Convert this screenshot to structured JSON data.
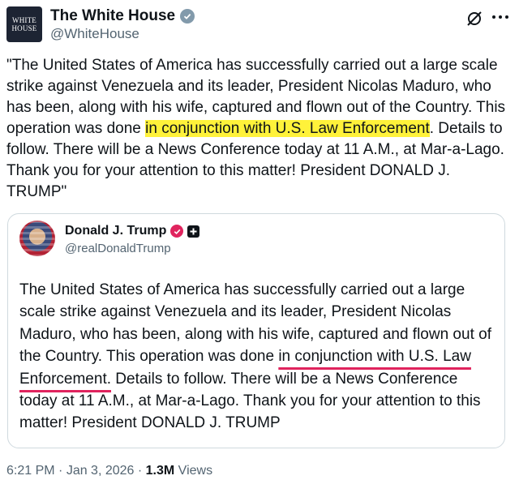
{
  "post": {
    "author_name": "The White House",
    "author_handle": "@WhiteHouse",
    "avatar_text_line1": "WHITE",
    "avatar_text_line2": "HOUSE",
    "text_before_highlight": "\"The United States of America has successfully carried out a large scale strike against Venezuela and its leader, President Nicolas Maduro, who has been, along with his wife, captured and flown out of the Country. This operation was done ",
    "text_highlight": "in conjunction with U.S. Law Enforcement",
    "text_after_highlight": ". Details to follow. There will be a News Conference today at 11 A.M., at Mar-a-Lago. Thank you for your attention to this matter! President DONALD J. TRUMP\"",
    "highlight_color": "#fff23a"
  },
  "quoted_post": {
    "author_name": "Donald J. Trump",
    "author_handle": "@realDonaldTrump",
    "text_before_underline": "The United States of America has successfully carried out a large scale strike against Venezuela and its leader, President Nicolas Maduro, who has been, along with his wife, captured and flown out of the Country. This operation was done ",
    "text_underlined": "in conjunction with U.S. Law Enforcement.",
    "text_after_underline": " Details to follow. There will be a News Conference today at 11 A.M., at Mar-a-Lago. Thank you for your attention to this matter! President DONALD J. TRUMP",
    "underline_color": "#e0245e",
    "badge_color": "#e0245e"
  },
  "meta": {
    "time": "6:21 PM",
    "separator1": " · ",
    "date": "Jan 3, 2026",
    "separator2": " · ",
    "views_count": "1.3M",
    "views_label": " Views"
  },
  "icons": {
    "verified": "verified-badge-icon",
    "grok": "grok-icon",
    "more": "more-icon"
  },
  "colors": {
    "secondary_text": "#536471",
    "border": "#cfd9de",
    "gov_badge": "#829aab"
  }
}
